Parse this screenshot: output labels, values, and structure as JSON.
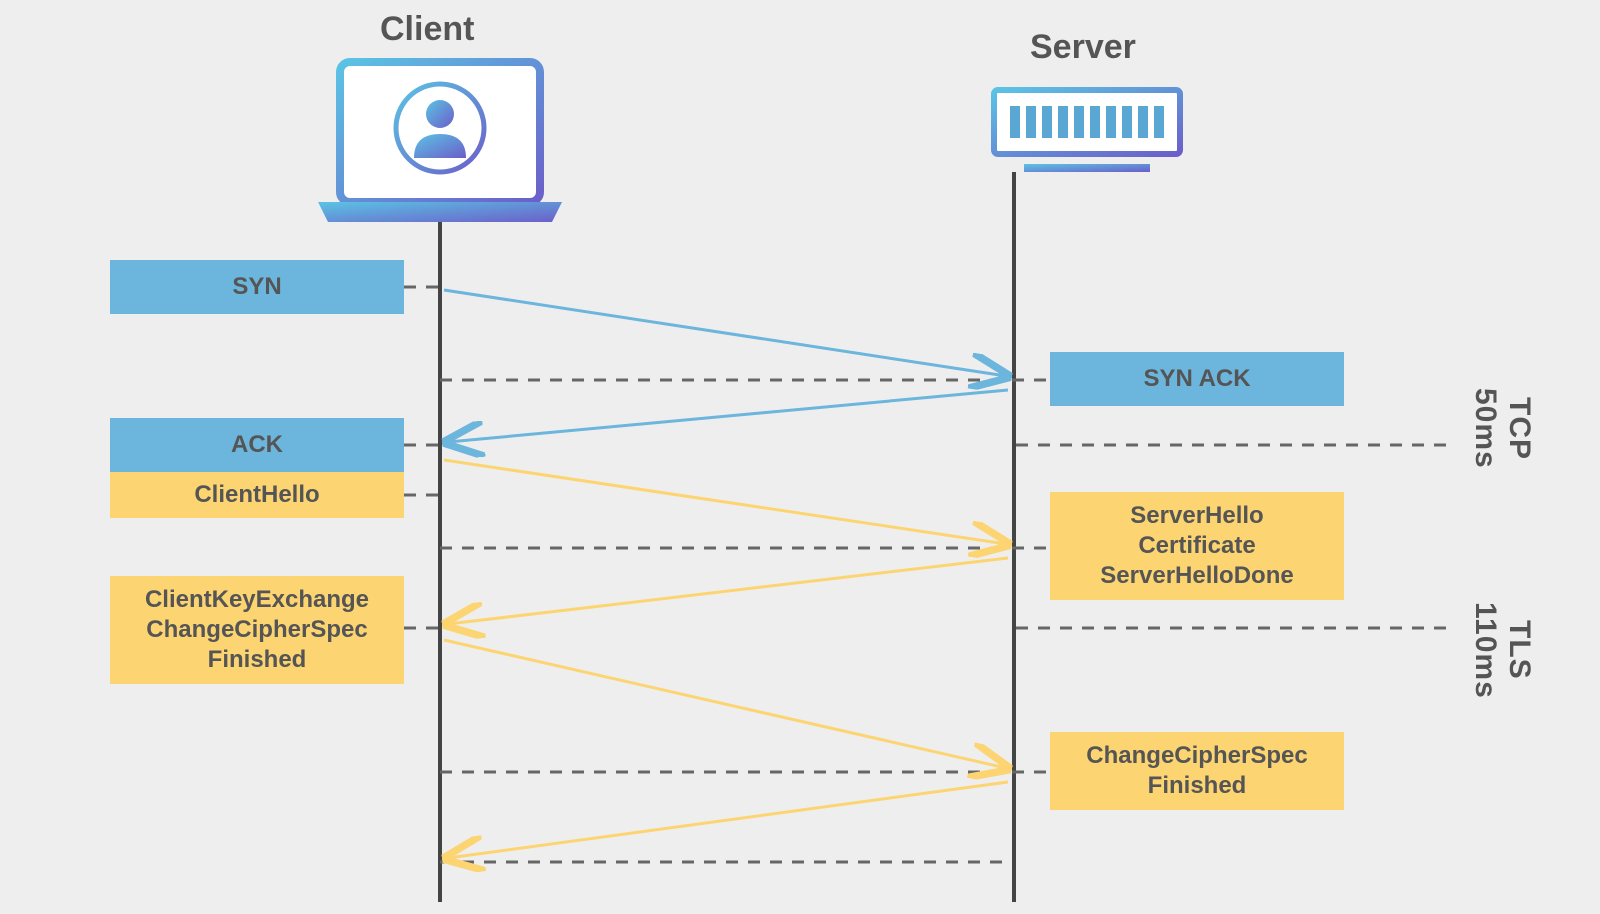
{
  "titles": {
    "client": "Client",
    "server": "Server"
  },
  "client_boxes": {
    "syn": "SYN",
    "ack": "ACK",
    "clienthello": "ClientHello",
    "cke": [
      "ClientKeyExchange",
      "ChangeCipherSpec",
      "Finished"
    ]
  },
  "server_boxes": {
    "synack": "SYN ACK",
    "serverhello": [
      "ServerHello",
      "Certificate",
      "ServerHelloDone"
    ],
    "ccs": [
      "ChangeCipherSpec",
      "Finished"
    ]
  },
  "side": {
    "tcp_proto": "TCP",
    "tcp_time": "50ms",
    "tls_proto": "TLS",
    "tls_time": "110ms"
  },
  "colors": {
    "blue_stroke": "#6cb5dc",
    "yellow_stroke": "#fcd572",
    "dash": "#666"
  }
}
